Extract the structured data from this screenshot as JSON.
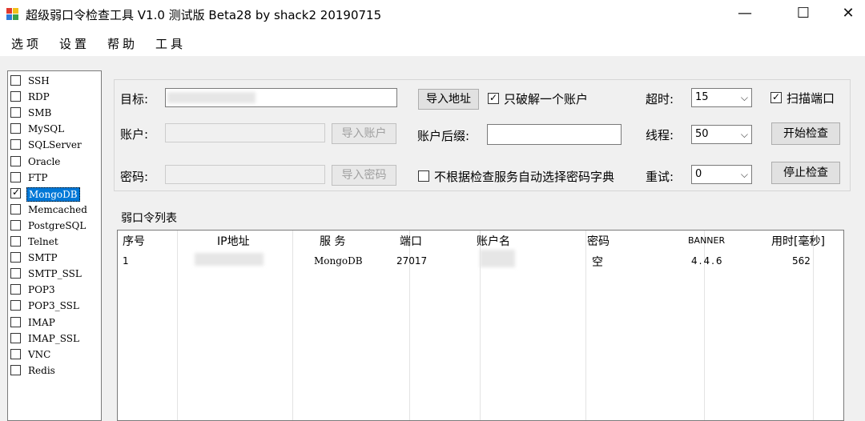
{
  "window": {
    "title": "超级弱口令检查工具 V1.0 测试版 Beta28 by shack2 20190715",
    "minimize": "—",
    "maximize": "☐",
    "close": "✕"
  },
  "menu": [
    "选项",
    "设置",
    "帮助",
    "工具"
  ],
  "services": [
    {
      "label": "SSH",
      "checked": false
    },
    {
      "label": "RDP",
      "checked": false
    },
    {
      "label": "SMB",
      "checked": false
    },
    {
      "label": "MySQL",
      "checked": false
    },
    {
      "label": "SQLServer",
      "checked": false
    },
    {
      "label": "Oracle",
      "checked": false
    },
    {
      "label": "FTP",
      "checked": false
    },
    {
      "label": "MongoDB",
      "checked": true,
      "selected": true
    },
    {
      "label": "Memcached",
      "checked": false
    },
    {
      "label": "PostgreSQL",
      "checked": false
    },
    {
      "label": "Telnet",
      "checked": false
    },
    {
      "label": "SMTP",
      "checked": false
    },
    {
      "label": "SMTP_SSL",
      "checked": false
    },
    {
      "label": "POP3",
      "checked": false
    },
    {
      "label": "POP3_SSL",
      "checked": false
    },
    {
      "label": "IMAP",
      "checked": false
    },
    {
      "label": "IMAP_SSL",
      "checked": false
    },
    {
      "label": "VNC",
      "checked": false
    },
    {
      "label": "Redis",
      "checked": false
    }
  ],
  "config": {
    "target_label": "目标:",
    "account_label": "账户:",
    "password_label": "密码:",
    "import_account": "导入账户",
    "import_password": "导入密码",
    "import_address": "导入地址",
    "only_one_account": "只破解一个账户",
    "account_suffix_label": "账户后缀:",
    "auto_dict": "不根据检查服务自动选择密码字典",
    "timeout_label": "超时:",
    "timeout_value": "15",
    "threads_label": "线程:",
    "threads_value": "50",
    "retry_label": "重试:",
    "retry_value": "0",
    "scan_port": "扫描端口",
    "start_check": "开始检查",
    "stop_check": "停止检查"
  },
  "results": {
    "title": "弱口令列表",
    "columns": [
      "序号",
      "IP地址",
      "服 务",
      "端口",
      "账户名",
      "密码",
      "BANNER",
      "用时[毫秒]"
    ],
    "rows": [
      [
        "1",
        "",
        "MongoDB",
        "27017",
        "",
        "空",
        "4.4.6",
        "562"
      ]
    ]
  },
  "icons": {
    "check": "✓",
    "dropdown": "⌵"
  }
}
